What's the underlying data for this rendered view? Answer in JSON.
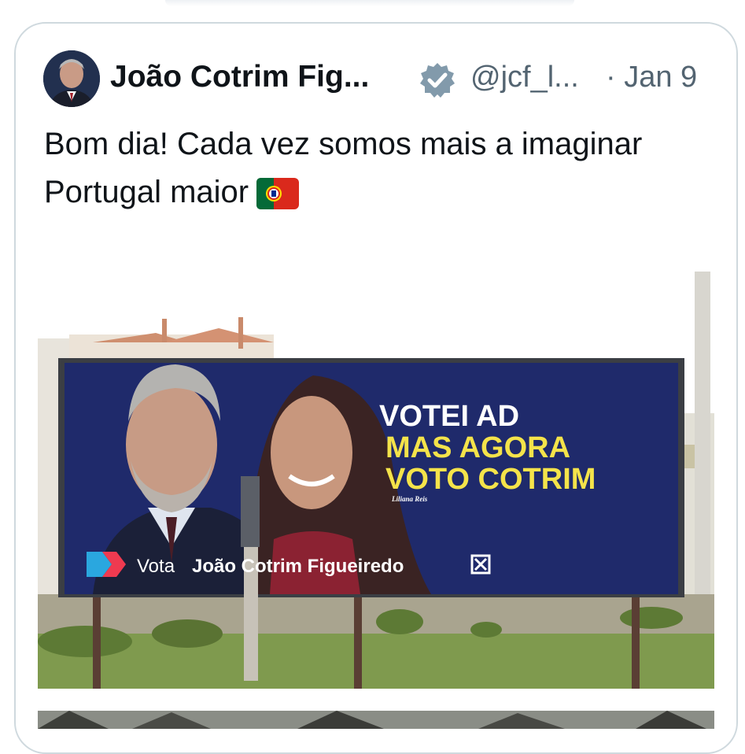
{
  "tweet": {
    "author_name": "João Cotrim Fig...",
    "handle": "@jcf_l...",
    "date": "· Jan 9",
    "text": "Bom dia! Cada vez somos mais a imaginar Portugal maior",
    "flag_emoji": "portugal-flag"
  },
  "billboard": {
    "line1": "VOTEI AD",
    "line2": "MAS AGORA",
    "line3": "VOTO COTRIM",
    "signature": "Liliana Reis",
    "footer_vota": "Vota",
    "footer_name": "João Cotrim Figueiredo",
    "colors": {
      "panel": "#1f2a6b",
      "headline": "#ffffff",
      "accent": "#f4e34a"
    }
  },
  "colors": {
    "text": "#0f1419",
    "muted": "#536471",
    "border": "#cfd9de",
    "verified": "#829aab"
  }
}
